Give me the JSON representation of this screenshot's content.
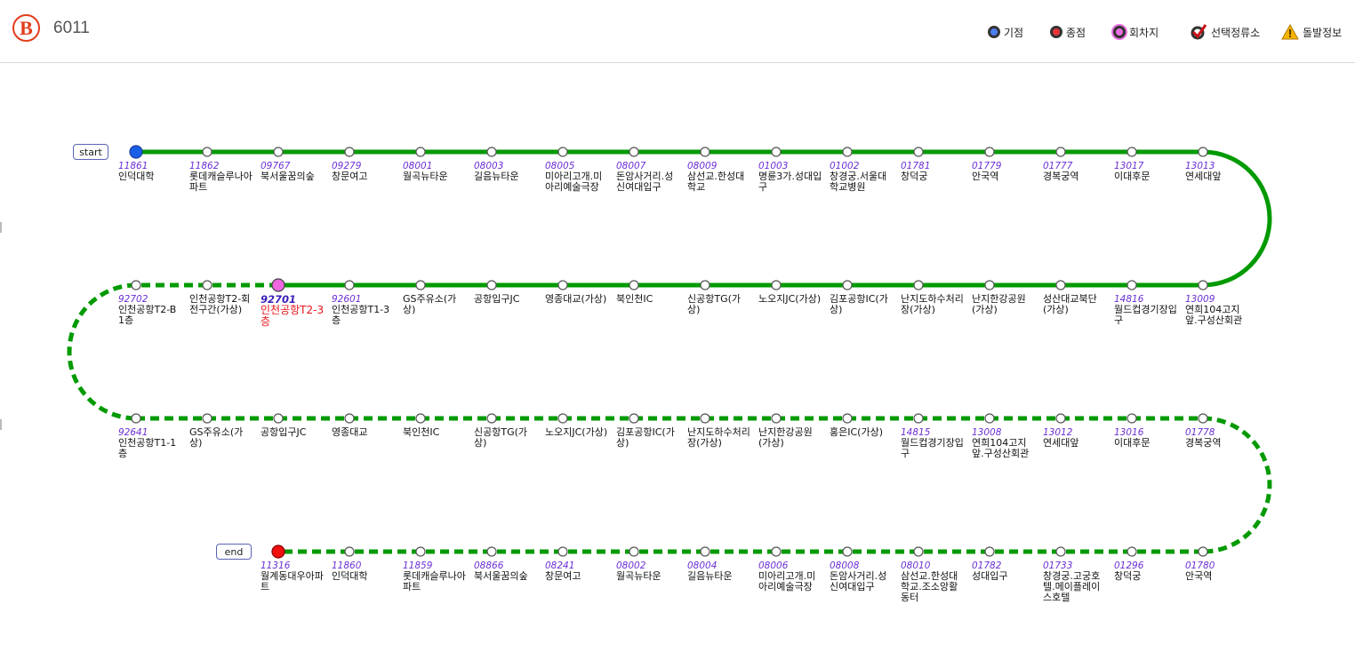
{
  "route": {
    "number": "6011",
    "brand_letter": "B"
  },
  "legend": [
    {
      "label": "기점",
      "icon": "start-point-icon",
      "color": "#4a7ef0"
    },
    {
      "label": "종점",
      "icon": "end-point-icon",
      "color": "#e8343a"
    },
    {
      "label": "회차지",
      "icon": "turnaround-icon",
      "color": "#e86fe0"
    },
    {
      "label": "선택정류소",
      "icon": "checkmark-icon",
      "color": "#d11"
    },
    {
      "label": "돌발정보",
      "icon": "warning-icon",
      "color": "#f5b400"
    }
  ],
  "markers": {
    "start": "start",
    "end": "end"
  },
  "colors": {
    "line": "#009a00",
    "stop_fill": "#ffffff"
  },
  "rows": [
    [
      {
        "id": "11861",
        "name": "인덕대학",
        "type": "start"
      },
      {
        "id": "11862",
        "name": "롯데캐슬루나아파트"
      },
      {
        "id": "09767",
        "name": "북서울꿈의숲"
      },
      {
        "id": "09279",
        "name": "창문여고"
      },
      {
        "id": "08001",
        "name": "월곡뉴타운"
      },
      {
        "id": "08003",
        "name": "길음뉴타운"
      },
      {
        "id": "08005",
        "name": "미아리고개.미아리예술극장"
      },
      {
        "id": "08007",
        "name": "돈암사거리.성신여대입구"
      },
      {
        "id": "08009",
        "name": "삼선교.한성대학교"
      },
      {
        "id": "01003",
        "name": "명륜3가.성대입구"
      },
      {
        "id": "01002",
        "name": "창경궁.서울대학교병원"
      },
      {
        "id": "01781",
        "name": "창덕궁"
      },
      {
        "id": "01779",
        "name": "안국역"
      },
      {
        "id": "01777",
        "name": "경복궁역"
      },
      {
        "id": "13017",
        "name": "이대후문"
      },
      {
        "id": "13013",
        "name": "연세대앞"
      }
    ],
    [
      {
        "id": "92702",
        "name": "인천공항T2-B1층"
      },
      {
        "id": "",
        "name": "인천공항T2-회전구간(가상)"
      },
      {
        "id": "92701",
        "name": "인천공항T2-3층",
        "type": "turn"
      },
      {
        "id": "92601",
        "name": "인천공항T1-3층"
      },
      {
        "id": "",
        "name": "GS주유소(가상)"
      },
      {
        "id": "",
        "name": "공항입구JC"
      },
      {
        "id": "",
        "name": "영종대교(가상)"
      },
      {
        "id": "",
        "name": "북인천IC"
      },
      {
        "id": "",
        "name": "신공항TG(가상)"
      },
      {
        "id": "",
        "name": "노오지JC(가상)"
      },
      {
        "id": "",
        "name": "김포공항IC(가상)"
      },
      {
        "id": "",
        "name": "난지도하수처리장(가상)"
      },
      {
        "id": "",
        "name": "난지한강공원(가상)"
      },
      {
        "id": "",
        "name": "성산대교북단(가상)"
      },
      {
        "id": "14816",
        "name": "월드컵경기장입구"
      },
      {
        "id": "13009",
        "name": "연희104고지앞.구성산회관"
      }
    ],
    [
      {
        "id": "92641",
        "name": "인천공항T1-1층"
      },
      {
        "id": "",
        "name": "GS주유소(가상)"
      },
      {
        "id": "",
        "name": "공항입구JC"
      },
      {
        "id": "",
        "name": "영종대교"
      },
      {
        "id": "",
        "name": "북인천IC"
      },
      {
        "id": "",
        "name": "신공항TG(가상)"
      },
      {
        "id": "",
        "name": "노오지JC(가상)"
      },
      {
        "id": "",
        "name": "김포공항IC(가상)"
      },
      {
        "id": "",
        "name": "난지도하수처리장(가상)"
      },
      {
        "id": "",
        "name": "난지한강공원(가상)"
      },
      {
        "id": "",
        "name": "홍은IC(가상)"
      },
      {
        "id": "14815",
        "name": "월드컵경기장입구"
      },
      {
        "id": "13008",
        "name": "연희104고지앞.구성산회관"
      },
      {
        "id": "13012",
        "name": "연세대앞"
      },
      {
        "id": "13016",
        "name": "이대후문"
      },
      {
        "id": "01778",
        "name": "경복궁역"
      }
    ],
    [
      {
        "id": "11316",
        "name": "월계동대우아파트",
        "type": "end"
      },
      {
        "id": "11860",
        "name": "인덕대학"
      },
      {
        "id": "11859",
        "name": "롯데캐슬루나아파트"
      },
      {
        "id": "08866",
        "name": "북서울꿈의숲"
      },
      {
        "id": "08241",
        "name": "창문여고"
      },
      {
        "id": "08002",
        "name": "월곡뉴타운"
      },
      {
        "id": "08004",
        "name": "길음뉴타운"
      },
      {
        "id": "08006",
        "name": "미아리고개.미아리예술극장"
      },
      {
        "id": "08008",
        "name": "돈암사거리.성신여대입구"
      },
      {
        "id": "08010",
        "name": "삼선교.한성대학교.조소앙활동터"
      },
      {
        "id": "01782",
        "name": "성대입구"
      },
      {
        "id": "01733",
        "name": "창경궁.고궁호텔.메이플레이스호텔"
      },
      {
        "id": "01296",
        "name": "창덕궁"
      },
      {
        "id": "01780",
        "name": "안국역"
      }
    ]
  ]
}
